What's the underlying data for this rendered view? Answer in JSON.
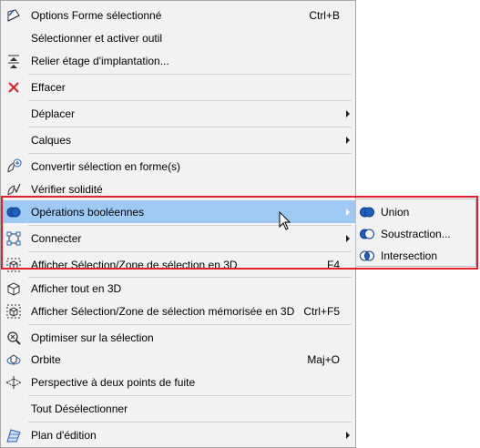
{
  "menu": {
    "items": [
      {
        "label": "Options Forme sélectionné",
        "shortcut": "Ctrl+B",
        "icon": "shape-options-icon",
        "arrow": false
      },
      {
        "label": "Sélectionner et activer outil",
        "shortcut": "",
        "icon": "",
        "arrow": false
      },
      {
        "label": "Relier étage d'implantation...",
        "shortcut": "",
        "icon": "home-story-link-icon",
        "arrow": false
      },
      {
        "label": "Effacer",
        "shortcut": "",
        "icon": "delete-x-icon",
        "arrow": false
      },
      {
        "label": "Déplacer",
        "shortcut": "",
        "icon": "",
        "arrow": true
      },
      {
        "label": "Calques",
        "shortcut": "",
        "icon": "",
        "arrow": true
      },
      {
        "label": "Convertir sélection en forme(s)",
        "shortcut": "",
        "icon": "convert-to-shape-icon",
        "arrow": false
      },
      {
        "label": "Vérifier solidité",
        "shortcut": "",
        "icon": "check-solidity-icon",
        "arrow": false
      },
      {
        "label": "Opérations booléennes",
        "shortcut": "",
        "icon": "boolean-operations-icon",
        "arrow": true
      },
      {
        "label": "Connecter",
        "shortcut": "",
        "icon": "connect-icon",
        "arrow": true
      },
      {
        "label": "Afficher Sélection/Zone de sélection en 3D",
        "shortcut": "F4",
        "icon": "show-selection-3d-icon",
        "arrow": false
      },
      {
        "label": "Afficher tout en 3D",
        "shortcut": "",
        "icon": "show-all-3d-icon",
        "arrow": false
      },
      {
        "label": "Afficher Sélection/Zone de sélection mémorisée en 3D",
        "shortcut": "Ctrl+F5",
        "icon": "show-stored-selection-3d-icon",
        "arrow": false
      },
      {
        "label": "Optimiser sur la sélection",
        "shortcut": "",
        "icon": "fit-selection-icon",
        "arrow": false
      },
      {
        "label": "Orbite",
        "shortcut": "Maj+O",
        "icon": "orbit-icon",
        "arrow": false
      },
      {
        "label": "Perspective à deux points de fuite",
        "shortcut": "",
        "icon": "two-point-perspective-icon",
        "arrow": false
      },
      {
        "label": "Tout Désélectionner",
        "shortcut": "",
        "icon": "",
        "arrow": false
      },
      {
        "label": "Plan d'édition",
        "shortcut": "",
        "icon": "editing-plane-icon",
        "arrow": true
      }
    ],
    "highlighted": "Opérations booléennes"
  },
  "submenu": {
    "items": [
      {
        "label": "Union",
        "icon": "union-icon"
      },
      {
        "label": "Soustraction...",
        "icon": "subtraction-icon"
      },
      {
        "label": "Intersection",
        "icon": "intersection-icon"
      }
    ]
  },
  "colors": {
    "highlight": "#9ec9f2",
    "annotation_border": "#e0202a",
    "icon_blue": "#1f5fbf"
  }
}
